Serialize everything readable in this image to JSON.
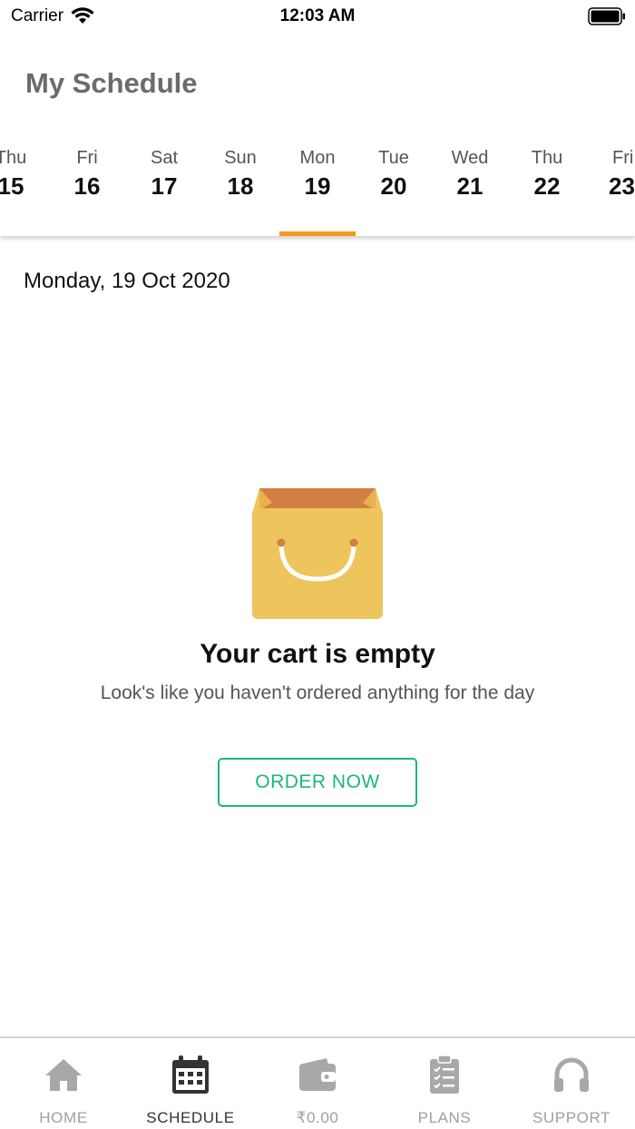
{
  "status_bar": {
    "carrier": "Carrier",
    "time": "12:03 AM"
  },
  "header": {
    "title": "My Schedule"
  },
  "days": [
    {
      "weekday": "Thu",
      "date": "15"
    },
    {
      "weekday": "Fri",
      "date": "16"
    },
    {
      "weekday": "Sat",
      "date": "17"
    },
    {
      "weekday": "Sun",
      "date": "18"
    },
    {
      "weekday": "Mon",
      "date": "19",
      "selected": true
    },
    {
      "weekday": "Tue",
      "date": "20"
    },
    {
      "weekday": "Wed",
      "date": "21"
    },
    {
      "weekday": "Thu",
      "date": "22"
    },
    {
      "weekday": "Fri",
      "date": "23"
    }
  ],
  "selected_date_label": "Monday, 19 Oct 2020",
  "empty_state": {
    "icon": "shopping-bag-icon",
    "title": "Your cart is empty",
    "subtitle": "Look's like you haven't ordered anything for the day",
    "button_label": "ORDER NOW"
  },
  "tabs": [
    {
      "label": "HOME",
      "icon": "home-icon"
    },
    {
      "label": "SCHEDULE",
      "icon": "calendar-icon",
      "active": true
    },
    {
      "label": "₹0.00",
      "icon": "wallet-icon"
    },
    {
      "label": "PLANS",
      "icon": "clipboard-icon"
    },
    {
      "label": "SUPPORT",
      "icon": "headphones-icon"
    }
  ],
  "colors": {
    "accent": "#f29a1f",
    "primary_green": "#1fb57f",
    "bag_body": "#eec55c",
    "bag_inner": "#d27f42"
  }
}
